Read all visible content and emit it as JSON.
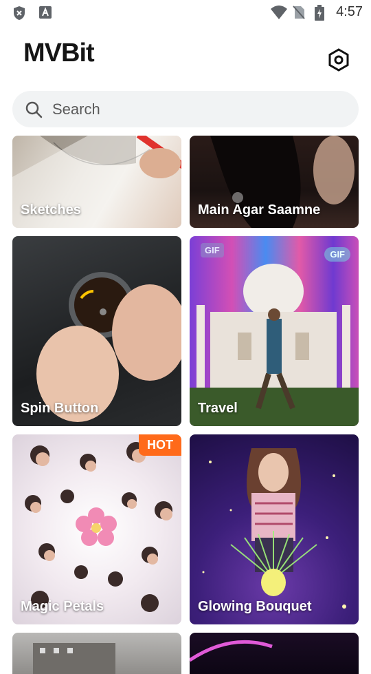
{
  "status_bar": {
    "time": "4:57",
    "left_icons": [
      "shield-icon",
      "font-a-icon"
    ],
    "right_icons": [
      "wifi-icon",
      "no-sim-icon",
      "battery-charging-icon"
    ]
  },
  "header": {
    "logo": "MVBit",
    "settings_icon": "hexagon-settings-icon"
  },
  "search": {
    "placeholder": "Search",
    "icon": "search-icon"
  },
  "cards": [
    {
      "label": "Sketches"
    },
    {
      "label": "Main Agar Saamne"
    },
    {
      "label": "Spin Button"
    },
    {
      "label": "Travel",
      "badge_left": "GIF",
      "badge_right": "GIF"
    },
    {
      "label": "Magic Petals",
      "badge": "HOT"
    },
    {
      "label": "Glowing Bouquet"
    },
    {
      "label": ""
    },
    {
      "label": ""
    }
  ],
  "colors": {
    "hot_badge": "#ff6a1a",
    "search_bg": "#f1f3f4"
  }
}
